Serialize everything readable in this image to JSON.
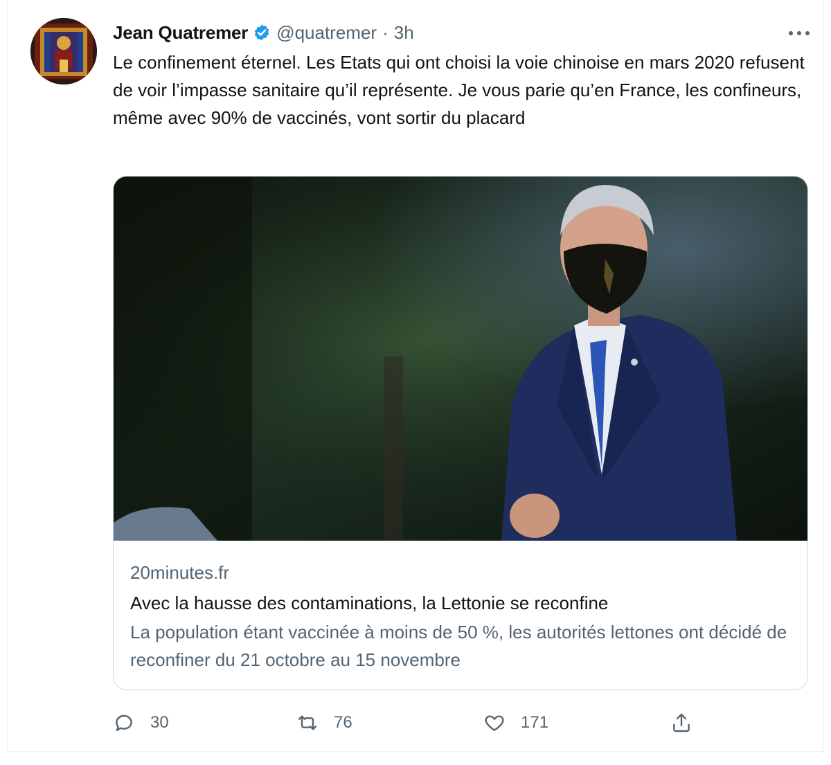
{
  "tweet": {
    "author_name": "Jean Quatremer",
    "handle": "@quatremer",
    "separator": "·",
    "time": "3h",
    "text": "Le confinement éternel. Les Etats qui ont choisi la voie chinoise en mars 2020 refusent de voir l’impasse sanitaire qu’il représente. Je vous parie qu’en France, les confineurs, même avec 90% de vaccinés, vont sortir du placard"
  },
  "card": {
    "domain": "20minutes.fr",
    "headline": "Avec la hausse des contaminations, la Lettonie se reconfine",
    "description": "La population étant vaccinée à moins de 50 %, les autorités lettones ont décidé de reconfiner du 21 octobre au 15 novembre"
  },
  "actions": {
    "replies": "30",
    "retweets": "76",
    "likes": "171"
  },
  "icons": {
    "verified": "verified-badge-icon",
    "more": "more-horizontal-icon",
    "reply": "speech-bubble-icon",
    "retweet": "retweet-arrows-icon",
    "like": "heart-icon",
    "share": "share-upload-icon"
  },
  "colors": {
    "verified_blue": "#1d9bf0",
    "secondary_text": "#536471",
    "border": "#cfd9de"
  }
}
